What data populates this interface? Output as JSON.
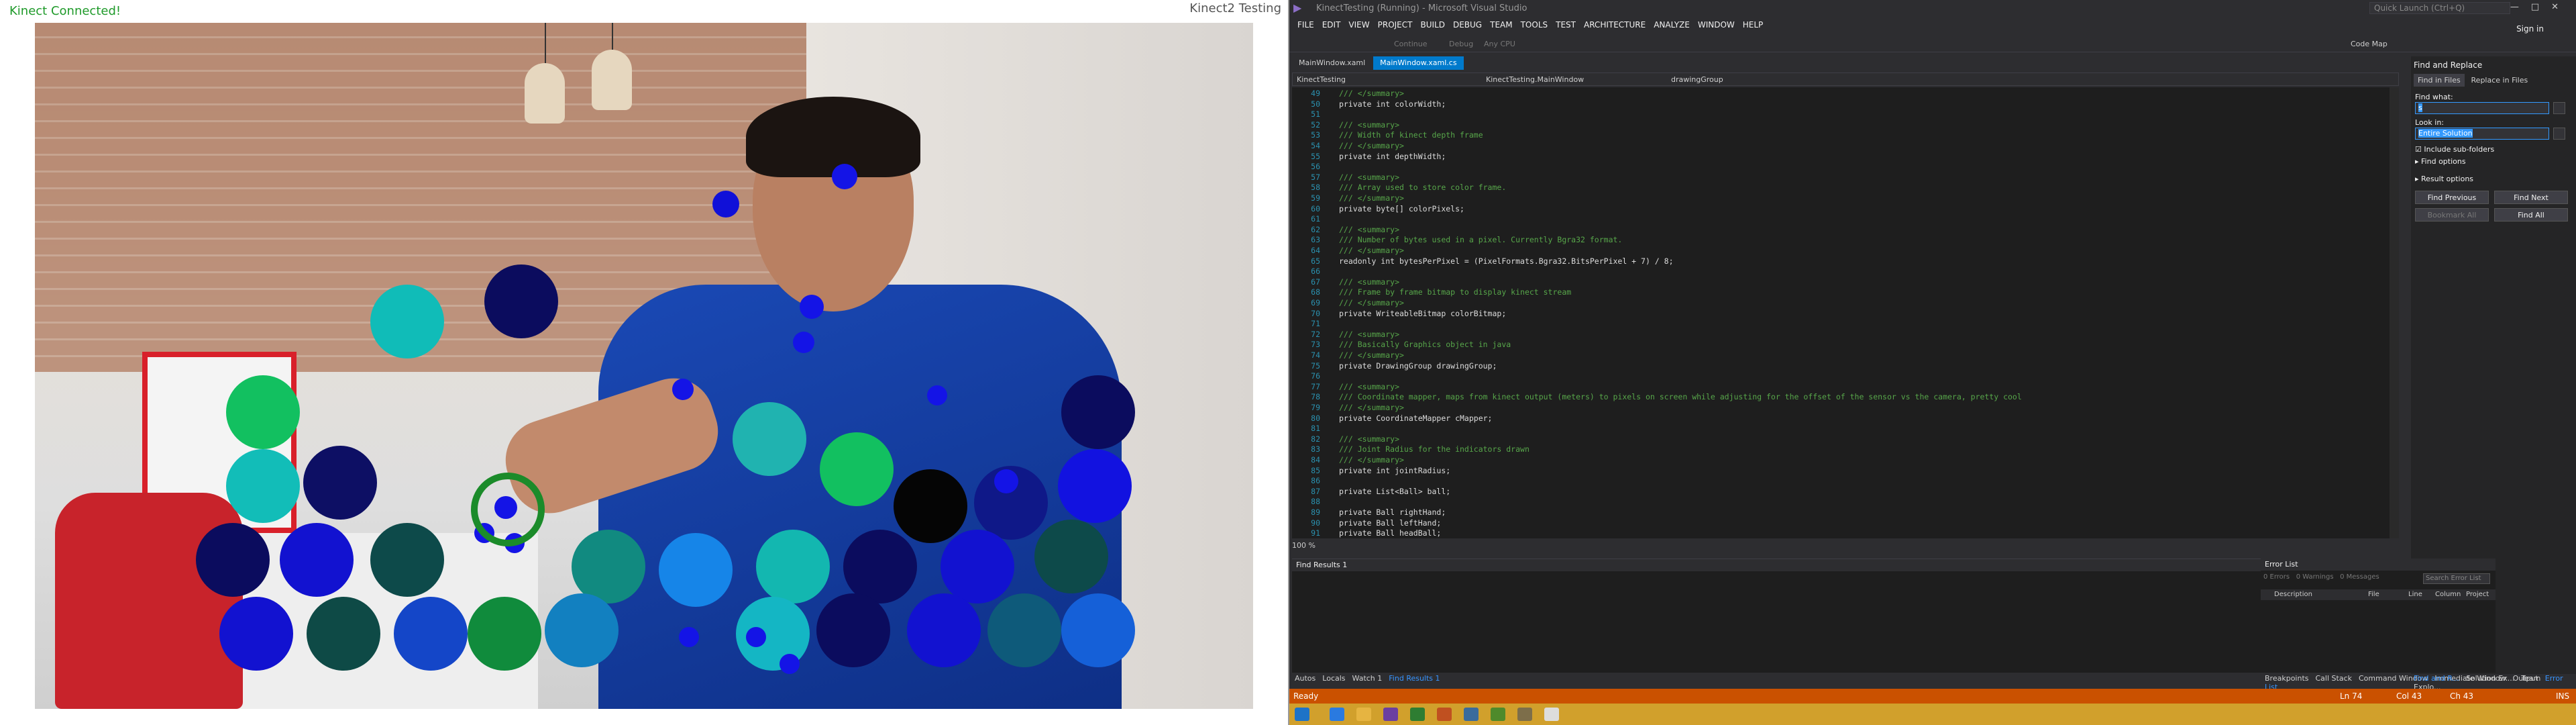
{
  "kinect_app": {
    "status": "Kinect Connected!",
    "window_title": "Kinect2 Testing"
  },
  "vs": {
    "title": "KinectTesting (Running) - Microsoft Visual Studio",
    "quick_launch": "Quick Launch (Ctrl+Q)",
    "sign_in": "Sign in",
    "menu": [
      "FILE",
      "EDIT",
      "VIEW",
      "PROJECT",
      "BUILD",
      "DEBUG",
      "TEAM",
      "TOOLS",
      "TEST",
      "ARCHITECTURE",
      "ANALYZE",
      "WINDOW",
      "HELP"
    ],
    "toolbar": {
      "continue": "Continue",
      "debug": "Debug",
      "cpu": "Any CPU",
      "codemap": "Code Map"
    },
    "tabs": [
      "MainWindow.xaml",
      "MainWindow.xaml.cs"
    ],
    "nav": {
      "project": "KinectTesting",
      "class": "KinectTesting.MainWindow",
      "member": "drawingGroup"
    },
    "zoom": "100 %",
    "code_lines": [
      {
        "n": "49",
        "t": "/// </summary>",
        "c": "cm"
      },
      {
        "n": "50",
        "t": "private int colorWidth;",
        "c": "tx"
      },
      {
        "n": "51",
        "t": "",
        "c": "tx"
      },
      {
        "n": "52",
        "t": "/// <summary>",
        "c": "cm"
      },
      {
        "n": "53",
        "t": "/// Width of kinect depth frame",
        "c": "cm"
      },
      {
        "n": "54",
        "t": "/// </summary>",
        "c": "cm"
      },
      {
        "n": "55",
        "t": "private int depthWidth;",
        "c": "tx"
      },
      {
        "n": "56",
        "t": "",
        "c": "tx"
      },
      {
        "n": "57",
        "t": "/// <summary>",
        "c": "cm"
      },
      {
        "n": "58",
        "t": "/// Array used to store color frame.",
        "c": "cm"
      },
      {
        "n": "59",
        "t": "/// </summary>",
        "c": "cm"
      },
      {
        "n": "60",
        "t": "private byte[] colorPixels;",
        "c": "tx"
      },
      {
        "n": "61",
        "t": "",
        "c": "tx"
      },
      {
        "n": "62",
        "t": "/// <summary>",
        "c": "cm"
      },
      {
        "n": "63",
        "t": "/// Number of bytes used in a pixel. Currently Bgra32 format.",
        "c": "cm"
      },
      {
        "n": "64",
        "t": "/// </summary>",
        "c": "cm"
      },
      {
        "n": "65",
        "t": "readonly int bytesPerPixel = (PixelFormats.Bgra32.BitsPerPixel + 7) / 8;",
        "c": "tx"
      },
      {
        "n": "66",
        "t": "",
        "c": "tx"
      },
      {
        "n": "67",
        "t": "/// <summary>",
        "c": "cm"
      },
      {
        "n": "68",
        "t": "/// Frame by frame bitmap to display kinect stream",
        "c": "cm"
      },
      {
        "n": "69",
        "t": "/// </summary>",
        "c": "cm"
      },
      {
        "n": "70",
        "t": "private WriteableBitmap colorBitmap;",
        "c": "tx"
      },
      {
        "n": "71",
        "t": "",
        "c": "tx"
      },
      {
        "n": "72",
        "t": "/// <summary>",
        "c": "cm"
      },
      {
        "n": "73",
        "t": "/// Basically Graphics object in java",
        "c": "cm"
      },
      {
        "n": "74",
        "t": "/// </summary>",
        "c": "cm"
      },
      {
        "n": "75",
        "t": "private DrawingGroup drawingGroup;",
        "c": "tx"
      },
      {
        "n": "76",
        "t": "",
        "c": "tx"
      },
      {
        "n": "77",
        "t": "/// <summary>",
        "c": "cm"
      },
      {
        "n": "78",
        "t": "/// Coordinate mapper, maps from kinect output (meters) to pixels on screen while adjusting for the offset of the sensor vs the camera, pretty cool",
        "c": "cm"
      },
      {
        "n": "79",
        "t": "/// </summary>",
        "c": "cm"
      },
      {
        "n": "80",
        "t": "private CoordinateMapper cMapper;",
        "c": "tx"
      },
      {
        "n": "81",
        "t": "",
        "c": "tx"
      },
      {
        "n": "82",
        "t": "/// <summary>",
        "c": "cm"
      },
      {
        "n": "83",
        "t": "/// Joint Radius for the indicators drawn",
        "c": "cm"
      },
      {
        "n": "84",
        "t": "/// </summary>",
        "c": "cm"
      },
      {
        "n": "85",
        "t": "private int jointRadius;",
        "c": "tx"
      },
      {
        "n": "86",
        "t": "",
        "c": "tx"
      },
      {
        "n": "87",
        "t": "private List<Ball> ball;",
        "c": "tx"
      },
      {
        "n": "88",
        "t": "",
        "c": "tx"
      },
      {
        "n": "89",
        "t": "private Ball rightHand;",
        "c": "tx"
      },
      {
        "n": "90",
        "t": "private Ball leftHand;",
        "c": "tx"
      },
      {
        "n": "91",
        "t": "private Ball headBall;",
        "c": "tx"
      }
    ],
    "find_replace": {
      "header": "Find and Replace",
      "tab_find": "Find in Files",
      "tab_replace": "Replace in Files",
      "find_what": "Find what:",
      "find_value": "s",
      "look_in": "Look in:",
      "look_in_value": "Entire Solution",
      "include_sub": "Include sub-folders",
      "find_options": "Find options",
      "result_options": "Result options",
      "find_previous": "Find Previous",
      "find_next": "Find Next",
      "bookmark_all": "Bookmark All",
      "find_all": "Find All"
    },
    "find_results": {
      "title": "Find Results 1"
    },
    "error_list": {
      "title": "Error List",
      "errors": "0 Errors",
      "warnings": "0 Warnings",
      "messages": "0 Messages",
      "search": "Search Error List",
      "cols": [
        "Description",
        "File",
        "Line",
        "Column",
        "Project"
      ]
    },
    "bottom_tabs_left": [
      "Autos",
      "Locals",
      "Watch 1",
      "Find Results 1"
    ],
    "bottom_tabs_right": [
      "Breakpoints",
      "Call Stack",
      "Command Window",
      "Immediate Window",
      "Output",
      "Error List"
    ],
    "bottom_tabs_fr": [
      "Find and R...",
      "Solution Ex...",
      "Team Explo..."
    ],
    "status": {
      "ready": "Ready",
      "ln": "Ln 74",
      "col": "Col 43",
      "ch": "Ch 43",
      "ins": "INS"
    }
  }
}
